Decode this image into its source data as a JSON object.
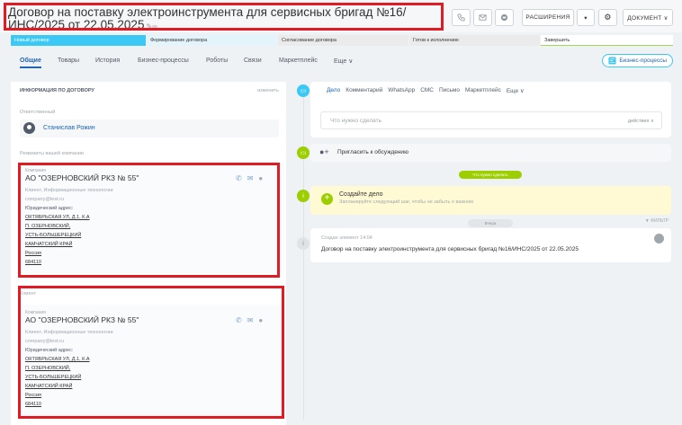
{
  "header": {
    "title": "Договор на поставку электроинструмента для сервисных бригад №16/ИНС/2025 от 22.05.2025",
    "edit_icons": "✎∞",
    "phone_icon": "phone-icon",
    "mail_icon": "mail-icon",
    "chat_icon": "chat-icon",
    "extensions_label": "РАСШИРЕНИЯ",
    "dropdown_icon": "▾",
    "settings_icon": "⚙",
    "document_label": "ДОКУМЕНТ ∨"
  },
  "stages": [
    {
      "label": "Новый договор"
    },
    {
      "label": "Формирование договора"
    },
    {
      "label": "Согласование договора"
    },
    {
      "label": "Готов к исполнению"
    },
    {
      "label": "Завершить"
    }
  ],
  "tabs": {
    "general": "Общие",
    "goods": "Товары",
    "history": "История",
    "bp": "Бизнес-процессы",
    "robots": "Роботы",
    "links": "Связи",
    "market": "Маркетплейс",
    "more": "Еще ∨",
    "bp_button": "Бизнес-процессы"
  },
  "info": {
    "heading": "ИНФОРМАЦИЯ ПО ДОГОВОРУ",
    "edit_link": "изменить",
    "responsible_label": "Ответственный",
    "responsible_name": "Станислав Рожин",
    "requisites_label": "Реквизиты вашей компании",
    "client_label": "Клиент"
  },
  "company_card": {
    "label": "Компания",
    "name": "АО \"ОЗЕРНОВСКИЙ РКЗ № 55\"",
    "type": "Клиент, Информационные технологии",
    "email": "company@test.ru",
    "addr_label": "Юридический адрес:",
    "addr1": "ОКТЯБРЬСКАЯ УЛ, Д.1, К.А",
    "addr2": "П. ОЗЕРНОВСКИЙ,",
    "addr3": "УСТЬ-БОЛЬШЕРЕЦКИЙ",
    "addr4": "КАМЧАТСКИЙ КРАЙ",
    "country": "Россия",
    "zip": "684110"
  },
  "timeline": {
    "tabs": [
      "Дело",
      "Комментарий",
      "WhatsApp",
      "СМС",
      "Письмо",
      "Маркетплейс",
      "Еще ∨"
    ],
    "placeholder": "Что нужно сделать",
    "actions": "действия ∨",
    "invite": "Пригласить к обсуждению",
    "todo_pill": "Что нужно сделать",
    "todo_title": "Создайте дело",
    "todo_hint": "Запланируйте следующий шаг, чтобы не забыть о важном",
    "yesterday": "Вчера",
    "filter": "▼ ФИЛЬТР",
    "created_label": "Создан элемент",
    "created_time": "14:04",
    "created_text": "Договор на поставку электроинструмента для сервисных бригад №16/ИНС/2025 от 22.05.2025"
  },
  "colors": {
    "accent": "#2066b0",
    "stage_active": "#3bc8f5",
    "highlight": "#e01b24",
    "todo_bg": "#fffad4",
    "green": "#9dcf00"
  }
}
